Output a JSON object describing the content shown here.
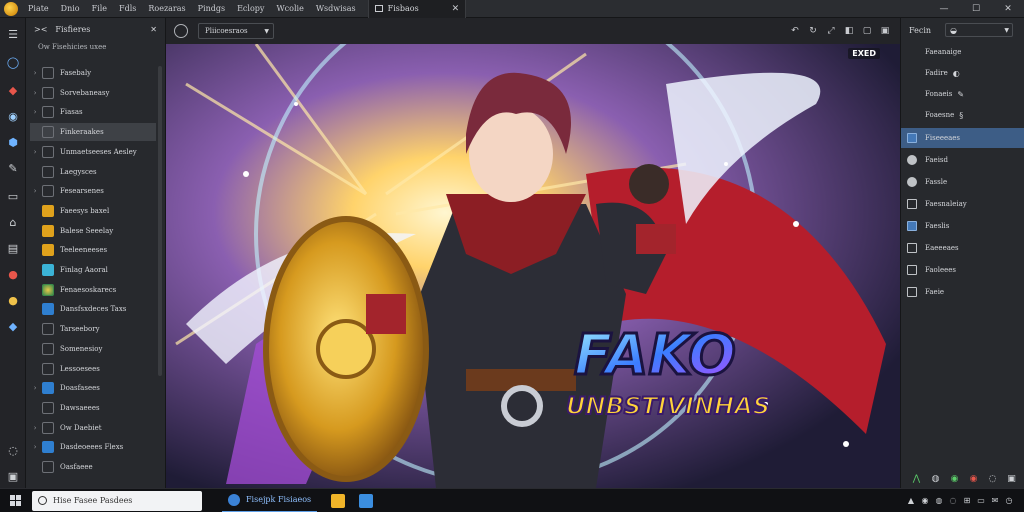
{
  "menu": {
    "items": [
      "Piate",
      "Dnio",
      "File",
      "Fdls",
      "Roezaras",
      "Pindgs",
      "Eclopy",
      "Wcolie",
      "Wsdwisas"
    ],
    "tab_label": "Fisbaos",
    "tab_close": "✕",
    "minimize": "—",
    "maximize": "☐",
    "close": "✕"
  },
  "layers": {
    "title": "Fisfieres",
    "close": "✕",
    "subtitle": "Ow Fisehicies uxee",
    "items": [
      {
        "label": "Fasebaly",
        "chevron": "›",
        "thumb": "box"
      },
      {
        "label": "Sorvebaneasy",
        "chevron": "›",
        "thumb": "box"
      },
      {
        "label": "Fiasas",
        "chevron": "›",
        "thumb": "box"
      },
      {
        "label": "Finkeraakes",
        "chevron": "",
        "thumb": "box",
        "selected": true
      },
      {
        "label": "Unmaetseeses Aesley",
        "chevron": "›",
        "thumb": "box"
      },
      {
        "label": "Laegysces",
        "chevron": "",
        "thumb": "box"
      },
      {
        "label": "Fesearsenes",
        "chevron": "›",
        "thumb": "box"
      },
      {
        "label": "Faeesys baxel",
        "chevron": "",
        "thumb": "gold"
      },
      {
        "label": "Balese Seeelay",
        "chevron": "",
        "thumb": "gold"
      },
      {
        "label": "Teeleeneeses",
        "chevron": "",
        "thumb": "gold"
      },
      {
        "label": "Finlag Aaoral",
        "chevron": "",
        "thumb": "cyan"
      },
      {
        "label": "Fenaesoskarecs",
        "chevron": "",
        "thumb": "green"
      },
      {
        "label": "Dansfsxdeces Taxs",
        "chevron": "",
        "thumb": "blue"
      },
      {
        "label": "Tarseebory",
        "chevron": "",
        "thumb": "box"
      },
      {
        "label": "Somenesioy",
        "chevron": "",
        "thumb": "box"
      },
      {
        "label": "Lessoesees",
        "chevron": "",
        "thumb": "box"
      },
      {
        "label": "Doasfasees",
        "chevron": "›",
        "thumb": "blue"
      },
      {
        "label": "Dawsaeees",
        "chevron": "",
        "thumb": "box"
      },
      {
        "label": "Ow Daebiet",
        "chevron": "›",
        "thumb": "box"
      },
      {
        "label": "Dasdeoeees Flexs",
        "chevron": "›",
        "thumb": "blue"
      },
      {
        "label": "Oasfaeee",
        "chevron": "",
        "thumb": "box"
      }
    ]
  },
  "canvasbar": {
    "view_label": "Pliicoesraos"
  },
  "canvas": {
    "badge": "EXED",
    "title_main": "FAKO",
    "title_sub": "UNBSTIVINHAS"
  },
  "props": {
    "title": "Fecin",
    "select_value": "",
    "rows": [
      {
        "label": "Faeanaige",
        "icon": ""
      },
      {
        "label": "Fadire",
        "icon": "◐"
      },
      {
        "label": "Fonaeis",
        "icon": "✎"
      },
      {
        "label": "Foaesne",
        "icon": "§"
      }
    ],
    "items": [
      {
        "label": "Fiseeeaes",
        "box": "filled",
        "selected": true
      },
      {
        "label": "Faeisd",
        "box": "round"
      },
      {
        "label": "Fassle",
        "box": "round"
      },
      {
        "label": "Faesnaleiay",
        "box": "box"
      },
      {
        "label": "Faeslis",
        "box": "filled"
      },
      {
        "label": "Eaeeeaes",
        "box": "box"
      },
      {
        "label": "Faoleees",
        "box": "box"
      },
      {
        "label": "Faeie",
        "box": "box"
      }
    ]
  },
  "taskbar": {
    "search_placeholder": "Hise Fasee Pasdees",
    "app_label": "Fisejpk Fisiaeos",
    "tray": [
      "▲",
      "◉",
      "◍",
      "◌",
      "⊞",
      "▭",
      "✉",
      "◷"
    ]
  }
}
